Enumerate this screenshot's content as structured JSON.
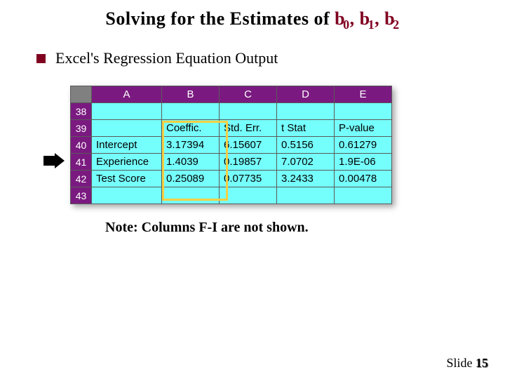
{
  "title_prefix": "Solving for the Estimates of ",
  "betas": [
    "b",
    "b",
    "b"
  ],
  "subs": [
    "0",
    "1",
    "2"
  ],
  "commas": [
    ", ",
    ", "
  ],
  "bullet": "Excel's Regression Equation Output",
  "col_headers": [
    "A",
    "B",
    "C",
    "D",
    "E"
  ],
  "rows": [
    {
      "num": "38",
      "cells": [
        "",
        "",
        "",
        "",
        ""
      ]
    },
    {
      "num": "39",
      "cells": [
        "",
        "Coeffic.",
        "Std. Err.",
        "t Stat",
        "P-value"
      ]
    },
    {
      "num": "40",
      "cells": [
        "Intercept",
        "3.17394",
        "6.15607",
        "0.5156",
        "0.61279"
      ]
    },
    {
      "num": "41",
      "cells": [
        "Experience",
        "1.4039",
        "0.19857",
        "7.0702",
        "1.9E-06"
      ]
    },
    {
      "num": "42",
      "cells": [
        "Test Score",
        "0.25089",
        "0.07735",
        "3.2433",
        "0.00478"
      ]
    },
    {
      "num": "43",
      "cells": [
        "",
        "",
        "",
        "",
        ""
      ]
    }
  ],
  "note": "Note:  Columns F-I are not shown.",
  "footer_label": "Slide ",
  "footer_num": "15"
}
